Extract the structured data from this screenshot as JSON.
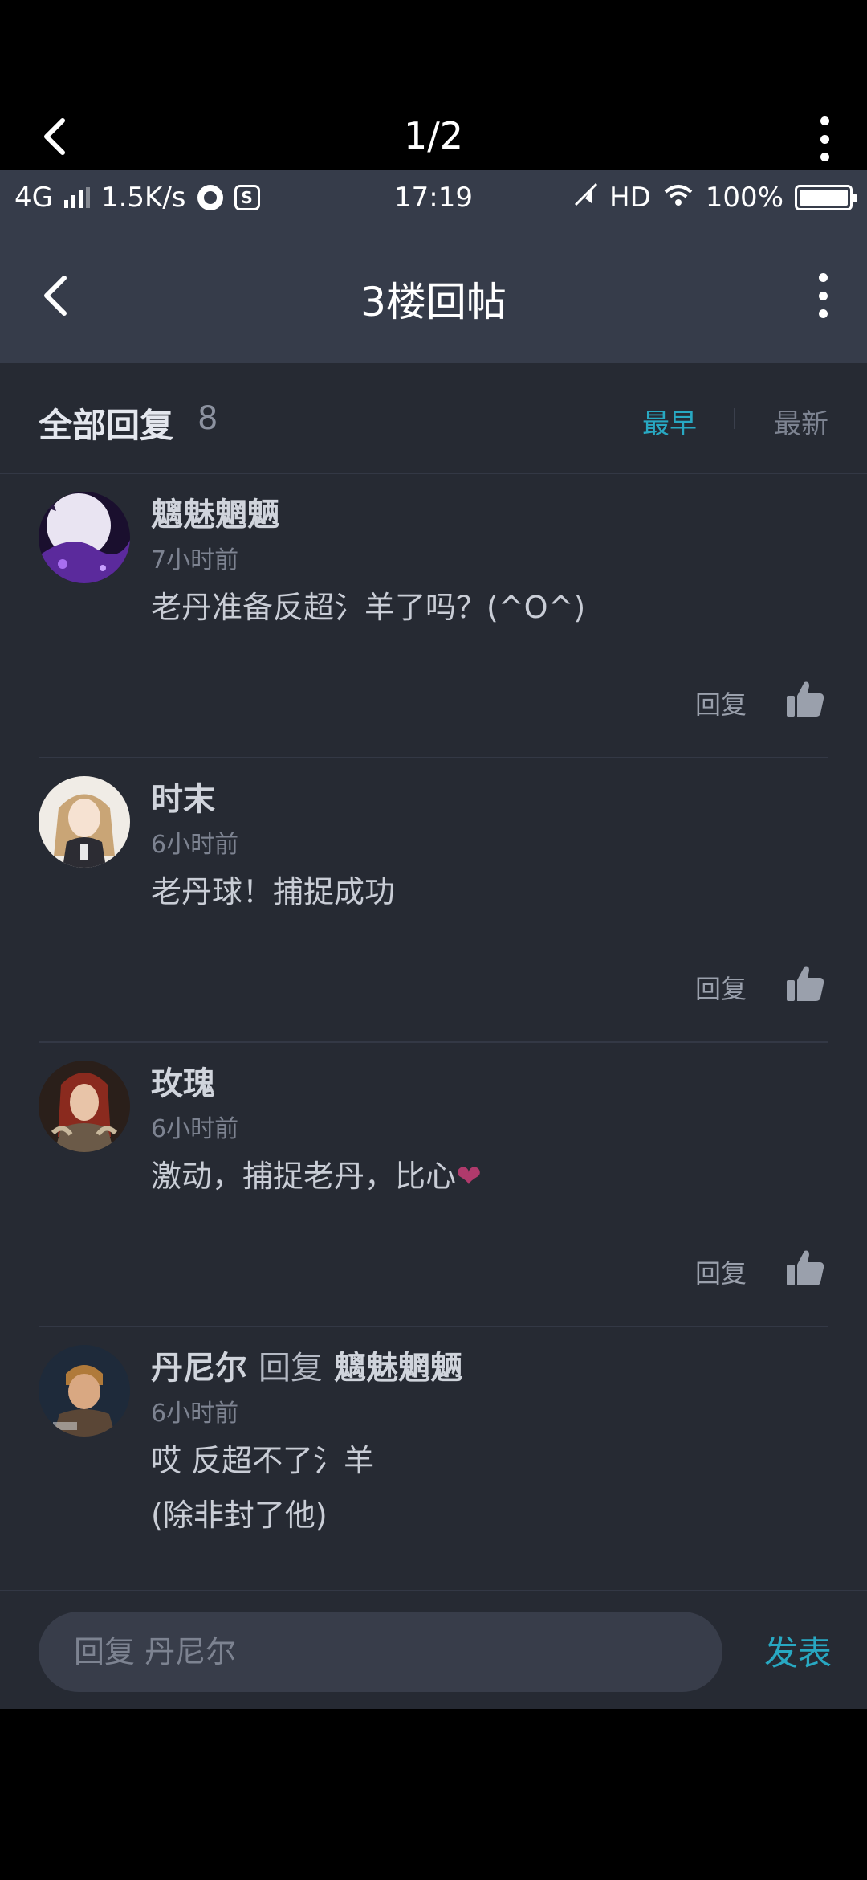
{
  "viewer": {
    "page_indicator": "1/2",
    "back_icon": "chevron-left-icon",
    "more_icon": "more-vertical-icon"
  },
  "statusbar": {
    "network": "4G",
    "speed": "1.5K/s",
    "time": "17:19",
    "hd": "HD",
    "battery": "100%"
  },
  "header": {
    "title": "3楼回帖"
  },
  "replies": {
    "title": "全部回复",
    "count": "8",
    "sort_earliest": "最早",
    "sort_newest": "最新",
    "active_sort": "最早",
    "accent_color": "#28a8c2"
  },
  "comments": [
    {
      "name": "魑魅魍魉",
      "time": "7小时前",
      "text": "老丹准备反超氵羊了吗？(^O^)",
      "reply_label": "回复"
    },
    {
      "name": "时末",
      "time": "6小时前",
      "text": "老丹球！捕捉成功",
      "reply_label": "回复"
    },
    {
      "name": "玫瑰",
      "time": "6小时前",
      "text": "激动，捕捉老丹，比心",
      "reply_label": "回复"
    },
    {
      "name": "丹尼尔",
      "reply_word": "回复",
      "reply_to": "魑魅魍魉",
      "time": "6小时前",
      "text_line1": "哎 反超不了氵羊",
      "text_line2": "(除非封了他)"
    }
  ],
  "composer": {
    "placeholder": "回复 丹尼尔",
    "send_label": "发表"
  }
}
